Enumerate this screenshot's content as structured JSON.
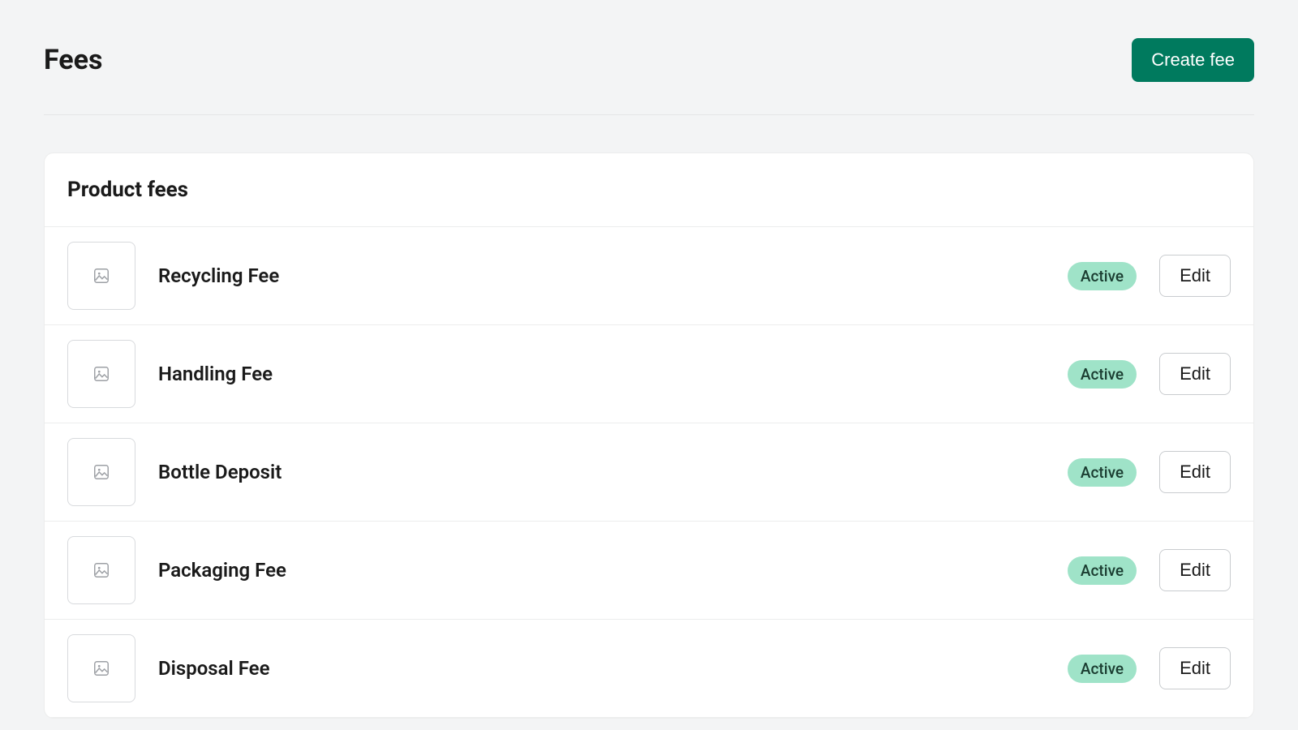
{
  "header": {
    "title": "Fees",
    "create_button": "Create fee"
  },
  "card": {
    "title": "Product fees",
    "edit_label": "Edit",
    "fees": [
      {
        "name": "Recycling Fee",
        "status": "Active"
      },
      {
        "name": "Handling Fee",
        "status": "Active"
      },
      {
        "name": "Bottle Deposit",
        "status": "Active"
      },
      {
        "name": "Packaging Fee",
        "status": "Active"
      },
      {
        "name": "Disposal Fee",
        "status": "Active"
      }
    ]
  }
}
